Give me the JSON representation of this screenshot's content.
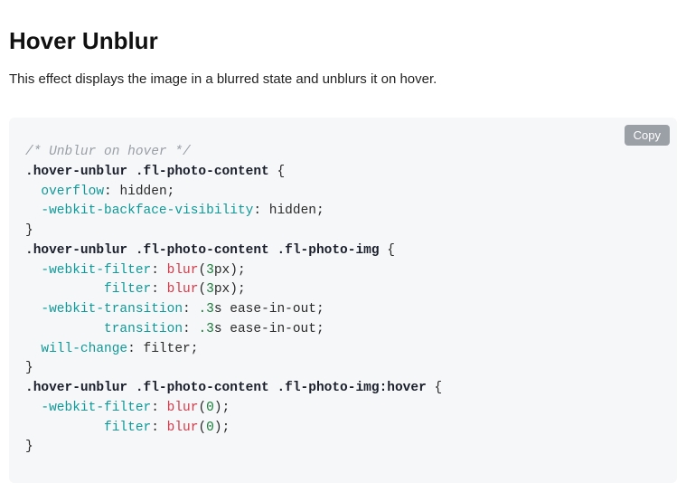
{
  "heading": "Hover Unblur",
  "description": "This effect displays the image in a blurred state and unblurs it on hover.",
  "copy_label": "Copy",
  "code": {
    "comment": "/* Unblur on hover */",
    "rules": [
      {
        "selector": ".hover-unblur .fl-photo-content",
        "decls": [
          {
            "prop": "overflow",
            "value": "hidden"
          },
          {
            "prop": "-webkit-backface-visibility",
            "value": "hidden"
          }
        ]
      },
      {
        "selector": ".hover-unblur .fl-photo-content .fl-photo-img",
        "decls": [
          {
            "prop": "-webkit-filter",
            "func": "blur",
            "args": "3",
            "unit": "px"
          },
          {
            "align_to": "-webkit-filter",
            "prop": "filter",
            "func": "blur",
            "args": "3",
            "unit": "px"
          },
          {
            "prop": "-webkit-transition",
            "value_parts": [
              ".3",
              "s ease-in-out"
            ],
            "num_first": true
          },
          {
            "align_to": "-webkit-transition",
            "prop": "transition",
            "value_parts": [
              ".3",
              "s ease-in-out"
            ],
            "num_first": true
          },
          {
            "prop": "will-change",
            "value": "filter"
          }
        ]
      },
      {
        "selector": ".hover-unblur .fl-photo-content .fl-photo-img:hover",
        "decls": [
          {
            "prop": "-webkit-filter",
            "func": "blur",
            "args": "0",
            "unit": ""
          },
          {
            "align_to": "-webkit-filter",
            "prop": "filter",
            "func": "blur",
            "args": "0",
            "unit": ""
          }
        ]
      }
    ]
  }
}
